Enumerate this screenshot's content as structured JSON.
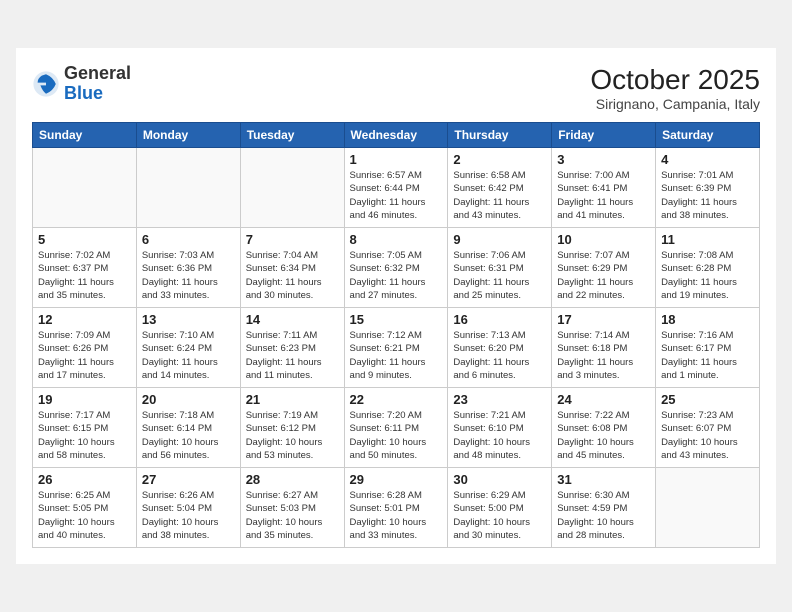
{
  "header": {
    "logo_general": "General",
    "logo_blue": "Blue",
    "month_year": "October 2025",
    "location": "Sirignano, Campania, Italy"
  },
  "weekdays": [
    "Sunday",
    "Monday",
    "Tuesday",
    "Wednesday",
    "Thursday",
    "Friday",
    "Saturday"
  ],
  "weeks": [
    [
      {
        "day": "",
        "info": ""
      },
      {
        "day": "",
        "info": ""
      },
      {
        "day": "",
        "info": ""
      },
      {
        "day": "1",
        "info": "Sunrise: 6:57 AM\nSunset: 6:44 PM\nDaylight: 11 hours\nand 46 minutes."
      },
      {
        "day": "2",
        "info": "Sunrise: 6:58 AM\nSunset: 6:42 PM\nDaylight: 11 hours\nand 43 minutes."
      },
      {
        "day": "3",
        "info": "Sunrise: 7:00 AM\nSunset: 6:41 PM\nDaylight: 11 hours\nand 41 minutes."
      },
      {
        "day": "4",
        "info": "Sunrise: 7:01 AM\nSunset: 6:39 PM\nDaylight: 11 hours\nand 38 minutes."
      }
    ],
    [
      {
        "day": "5",
        "info": "Sunrise: 7:02 AM\nSunset: 6:37 PM\nDaylight: 11 hours\nand 35 minutes."
      },
      {
        "day": "6",
        "info": "Sunrise: 7:03 AM\nSunset: 6:36 PM\nDaylight: 11 hours\nand 33 minutes."
      },
      {
        "day": "7",
        "info": "Sunrise: 7:04 AM\nSunset: 6:34 PM\nDaylight: 11 hours\nand 30 minutes."
      },
      {
        "day": "8",
        "info": "Sunrise: 7:05 AM\nSunset: 6:32 PM\nDaylight: 11 hours\nand 27 minutes."
      },
      {
        "day": "9",
        "info": "Sunrise: 7:06 AM\nSunset: 6:31 PM\nDaylight: 11 hours\nand 25 minutes."
      },
      {
        "day": "10",
        "info": "Sunrise: 7:07 AM\nSunset: 6:29 PM\nDaylight: 11 hours\nand 22 minutes."
      },
      {
        "day": "11",
        "info": "Sunrise: 7:08 AM\nSunset: 6:28 PM\nDaylight: 11 hours\nand 19 minutes."
      }
    ],
    [
      {
        "day": "12",
        "info": "Sunrise: 7:09 AM\nSunset: 6:26 PM\nDaylight: 11 hours\nand 17 minutes."
      },
      {
        "day": "13",
        "info": "Sunrise: 7:10 AM\nSunset: 6:24 PM\nDaylight: 11 hours\nand 14 minutes."
      },
      {
        "day": "14",
        "info": "Sunrise: 7:11 AM\nSunset: 6:23 PM\nDaylight: 11 hours\nand 11 minutes."
      },
      {
        "day": "15",
        "info": "Sunrise: 7:12 AM\nSunset: 6:21 PM\nDaylight: 11 hours\nand 9 minutes."
      },
      {
        "day": "16",
        "info": "Sunrise: 7:13 AM\nSunset: 6:20 PM\nDaylight: 11 hours\nand 6 minutes."
      },
      {
        "day": "17",
        "info": "Sunrise: 7:14 AM\nSunset: 6:18 PM\nDaylight: 11 hours\nand 3 minutes."
      },
      {
        "day": "18",
        "info": "Sunrise: 7:16 AM\nSunset: 6:17 PM\nDaylight: 11 hours\nand 1 minute."
      }
    ],
    [
      {
        "day": "19",
        "info": "Sunrise: 7:17 AM\nSunset: 6:15 PM\nDaylight: 10 hours\nand 58 minutes."
      },
      {
        "day": "20",
        "info": "Sunrise: 7:18 AM\nSunset: 6:14 PM\nDaylight: 10 hours\nand 56 minutes."
      },
      {
        "day": "21",
        "info": "Sunrise: 7:19 AM\nSunset: 6:12 PM\nDaylight: 10 hours\nand 53 minutes."
      },
      {
        "day": "22",
        "info": "Sunrise: 7:20 AM\nSunset: 6:11 PM\nDaylight: 10 hours\nand 50 minutes."
      },
      {
        "day": "23",
        "info": "Sunrise: 7:21 AM\nSunset: 6:10 PM\nDaylight: 10 hours\nand 48 minutes."
      },
      {
        "day": "24",
        "info": "Sunrise: 7:22 AM\nSunset: 6:08 PM\nDaylight: 10 hours\nand 45 minutes."
      },
      {
        "day": "25",
        "info": "Sunrise: 7:23 AM\nSunset: 6:07 PM\nDaylight: 10 hours\nand 43 minutes."
      }
    ],
    [
      {
        "day": "26",
        "info": "Sunrise: 6:25 AM\nSunset: 5:05 PM\nDaylight: 10 hours\nand 40 minutes."
      },
      {
        "day": "27",
        "info": "Sunrise: 6:26 AM\nSunset: 5:04 PM\nDaylight: 10 hours\nand 38 minutes."
      },
      {
        "day": "28",
        "info": "Sunrise: 6:27 AM\nSunset: 5:03 PM\nDaylight: 10 hours\nand 35 minutes."
      },
      {
        "day": "29",
        "info": "Sunrise: 6:28 AM\nSunset: 5:01 PM\nDaylight: 10 hours\nand 33 minutes."
      },
      {
        "day": "30",
        "info": "Sunrise: 6:29 AM\nSunset: 5:00 PM\nDaylight: 10 hours\nand 30 minutes."
      },
      {
        "day": "31",
        "info": "Sunrise: 6:30 AM\nSunset: 4:59 PM\nDaylight: 10 hours\nand 28 minutes."
      },
      {
        "day": "",
        "info": ""
      }
    ]
  ]
}
